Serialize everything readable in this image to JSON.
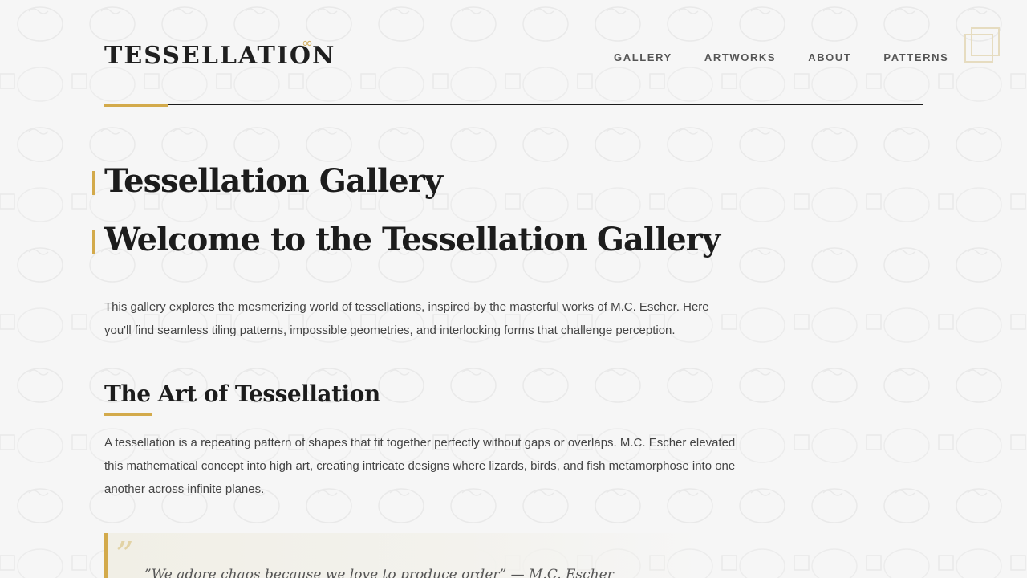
{
  "header": {
    "brand": "TESSELLATION",
    "brand_symbol": "∞",
    "nav": [
      {
        "label": "GALLERY"
      },
      {
        "label": "ARTWORKS"
      },
      {
        "label": "ABOUT"
      },
      {
        "label": "PATTERNS"
      }
    ],
    "corner_icon": "nested-squares-icon"
  },
  "main": {
    "title": "Tessellation Gallery",
    "welcome": "Welcome to the Tessellation Gallery",
    "intro": "This gallery explores the mesmerizing world of tessellations, inspired by the masterful works of M.C. Escher. Here you'll find seamless tiling patterns, impossible geometries, and interlocking forms that challenge perception.",
    "section_title": "The Art of Tessellation",
    "section_text": "A tessellation is a repeating pattern of shapes that fit together perfectly without gaps or overlaps. M.C. Escher elevated this mathematical concept into high art, creating intricate designs where lizards, birds, and fish metamorphose into one another across infinite planes.",
    "quote_mark": "”",
    "quote": "”We adore chaos because we love to produce order” — M.C. Escher"
  },
  "colors": {
    "accent": "#d3aa4b",
    "text": "#1c1c1c",
    "background": "#f6f6f6"
  }
}
